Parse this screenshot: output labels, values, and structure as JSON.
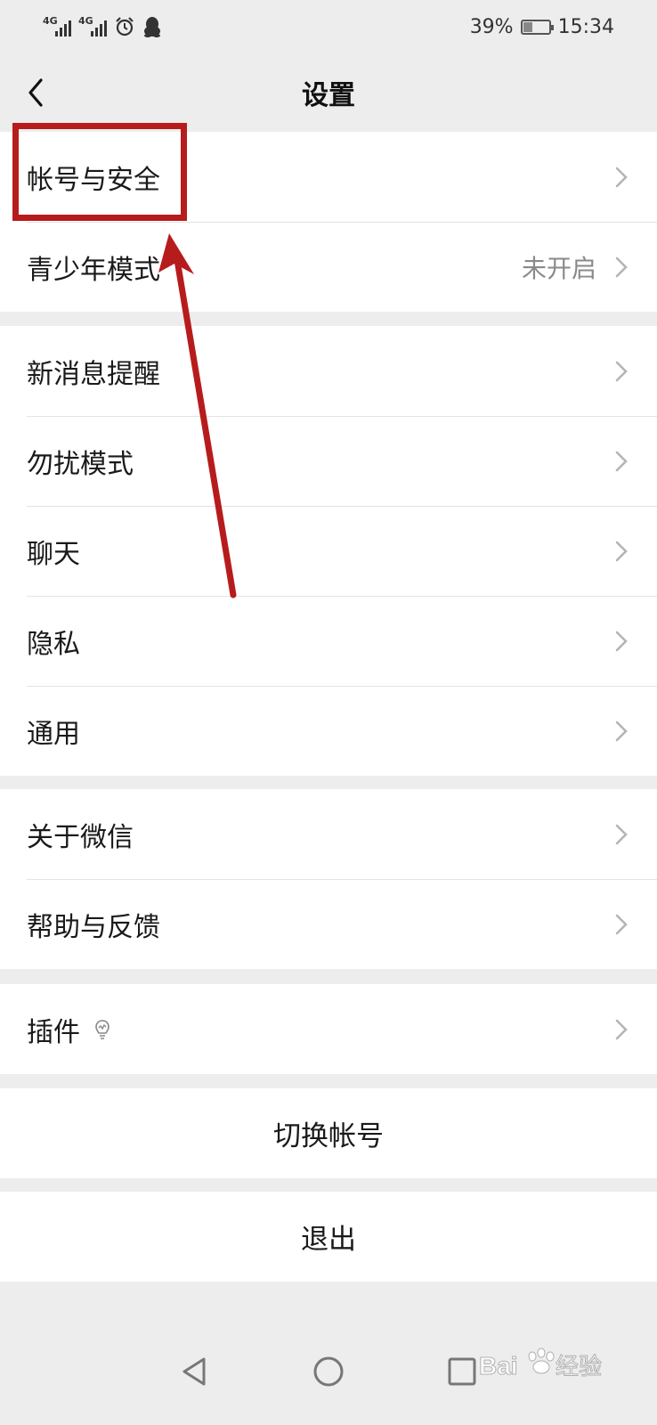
{
  "status_bar": {
    "network_1": "4G",
    "network_2": "4G",
    "battery_percent": "39%",
    "battery_level": 0.39,
    "time": "15:34",
    "icons": [
      "signal-icon",
      "signal-icon",
      "alarm-icon",
      "qq-icon",
      "battery-icon"
    ]
  },
  "nav": {
    "title": "设置",
    "back_icon": "chevron-left-icon"
  },
  "groups": [
    {
      "items": [
        {
          "label": "帐号与安全",
          "value": ""
        },
        {
          "label": "青少年模式",
          "value": "未开启"
        }
      ]
    },
    {
      "items": [
        {
          "label": "新消息提醒",
          "value": ""
        },
        {
          "label": "勿扰模式",
          "value": ""
        },
        {
          "label": "聊天",
          "value": ""
        },
        {
          "label": "隐私",
          "value": ""
        },
        {
          "label": "通用",
          "value": ""
        }
      ]
    },
    {
      "items": [
        {
          "label": "关于微信",
          "value": ""
        },
        {
          "label": "帮助与反馈",
          "value": ""
        }
      ]
    },
    {
      "items": [
        {
          "label": "插件",
          "value": "",
          "icon": "lightbulb-icon"
        }
      ]
    }
  ],
  "actions": {
    "switch_account": "切换帐号",
    "logout": "退出"
  },
  "annotation": {
    "color": "#b71c1c"
  },
  "watermark": {
    "text": "Baidu经验"
  }
}
